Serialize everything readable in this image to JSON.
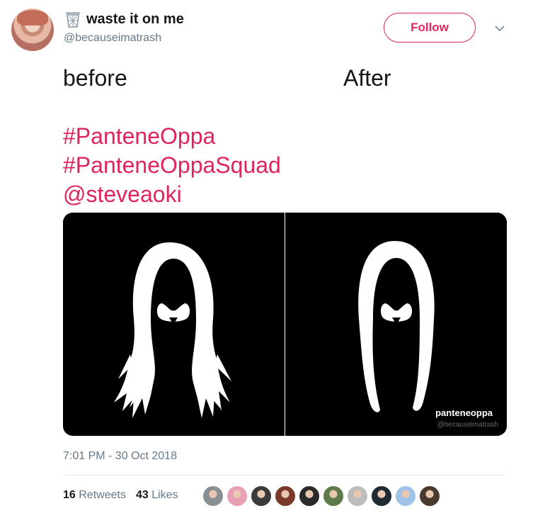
{
  "user": {
    "display_name": "waste it on me",
    "handle": "@becauseimatrash"
  },
  "follow_label": "Follow",
  "tweet": {
    "line_before": "before",
    "line_after": "After",
    "hashtag1": "#PanteneOppa",
    "hashtag2": "#PanteneOppaSquad",
    "mention": "@steveaoki"
  },
  "media": {
    "watermark_name": "panteneoppa",
    "watermark_handle": "@becauseimatrash"
  },
  "timestamp": "7:01 PM - 30 Oct 2018",
  "stats": {
    "retweets_count": "16",
    "retweets_label": "Retweets",
    "likes_count": "43",
    "likes_label": "Likes"
  },
  "colors": {
    "accent": "#e0245e",
    "muted": "#657786",
    "text": "#14171a"
  },
  "liker_avatars": [
    {
      "color": "#8a8f94"
    },
    {
      "color": "#e7a0b3"
    },
    {
      "color": "#3b3b3b"
    },
    {
      "color": "#7a3b2c"
    },
    {
      "color": "#2a2a2a"
    },
    {
      "color": "#5c7a4a"
    },
    {
      "color": "#bdbdbd"
    },
    {
      "color": "#1f2a33"
    },
    {
      "color": "#9ec3e6"
    },
    {
      "color": "#4a3a2e"
    }
  ]
}
